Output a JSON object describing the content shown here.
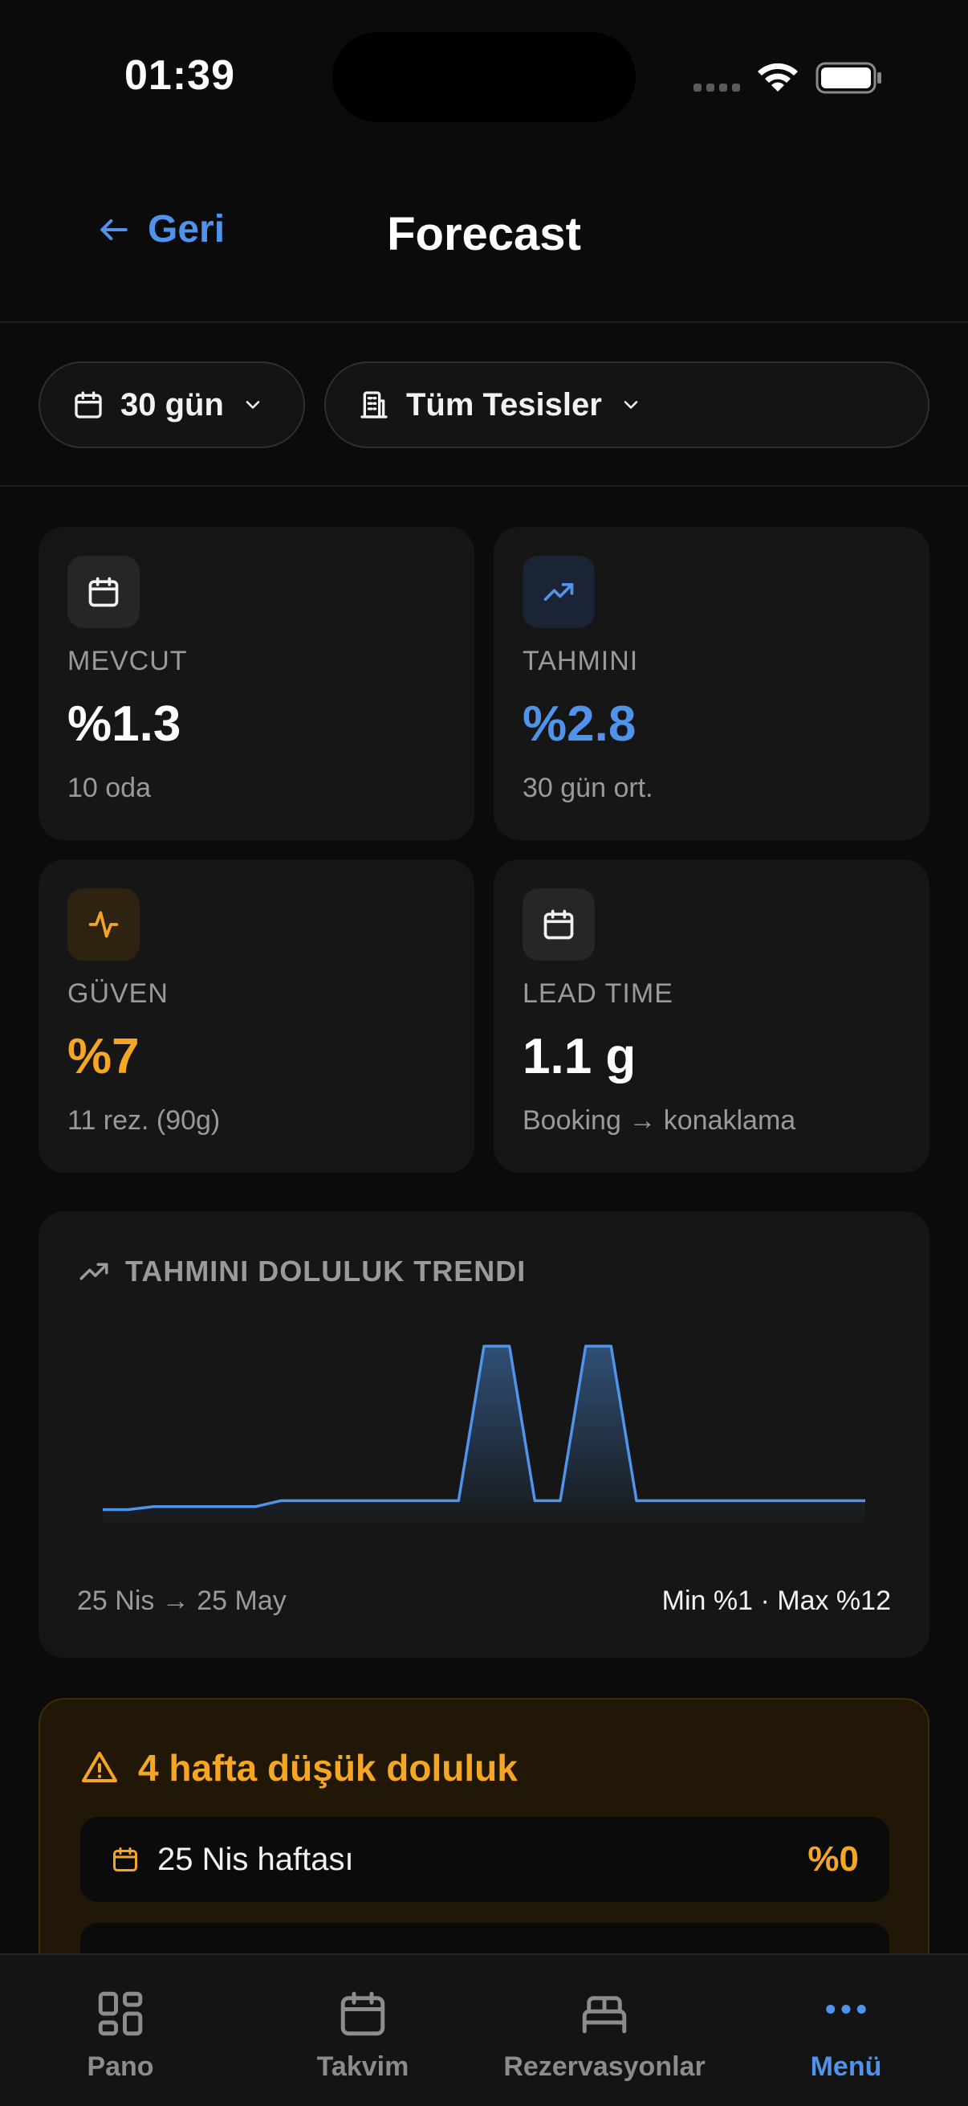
{
  "status_bar": {
    "time": "01:39"
  },
  "header": {
    "back_label": "Geri",
    "title": "Forecast"
  },
  "filters": {
    "period": "30 gün",
    "facility": "Tüm Tesisler"
  },
  "stats": [
    {
      "label": "MEVCUT",
      "value": "%1.3",
      "sub": "10 oda",
      "icon": "calendar-icon",
      "accent": "#ffffff"
    },
    {
      "label": "TAHMINI",
      "value": "%2.8",
      "sub": "30 gün ort.",
      "icon": "trending-up-icon",
      "accent": "#4f94ea"
    },
    {
      "label": "GÜVEN",
      "value": "%7",
      "sub": "11 rez. (90g)",
      "icon": "activity-icon",
      "accent": "#f5a623"
    },
    {
      "label": "LEAD TIME",
      "value": "1.1 g",
      "sub": "Booking → konaklama",
      "icon": "calendar-icon",
      "accent": "#ffffff"
    }
  ],
  "trend": {
    "title": "TAHMINI DOLULUK TRENDI",
    "range": "25 Nis → 25 May",
    "minmax": "Min %1 · Max %12"
  },
  "chart_data": {
    "type": "area",
    "title": "TAHMINI DOLULUK TRENDI",
    "x": [
      0,
      1,
      2,
      3,
      4,
      5,
      6,
      7,
      8,
      9,
      10,
      11,
      12,
      13,
      14,
      15,
      16,
      17,
      18,
      19,
      20,
      21,
      22,
      23,
      24,
      25,
      26,
      27,
      28,
      29,
      30
    ],
    "values": [
      1,
      1,
      1.2,
      1.2,
      1.2,
      1.2,
      1.2,
      1.6,
      1.6,
      1.6,
      1.6,
      1.6,
      1.6,
      1.6,
      1.6,
      12,
      12,
      1.6,
      1.6,
      12,
      12,
      1.6,
      1.6,
      1.6,
      1.6,
      1.6,
      1.6,
      1.6,
      1.6,
      1.6,
      1.6
    ],
    "ylim": [
      0,
      12
    ],
    "color": "#4f94ea"
  },
  "warning": {
    "title": "4 hafta düşük doluluk",
    "weeks": [
      {
        "label": "25 Nis haftası",
        "value": "%0"
      },
      {
        "label": "",
        "value": ""
      }
    ],
    "color": "#f5a623"
  },
  "tabbar": {
    "items": [
      {
        "label": "Pano",
        "icon": "dashboard-icon"
      },
      {
        "label": "Takvim",
        "icon": "calendar-icon"
      },
      {
        "label": "Rezervasyonlar",
        "icon": "bed-icon"
      },
      {
        "label": "Menü",
        "icon": "more-icon"
      }
    ],
    "active_color": "#4f94ea"
  }
}
